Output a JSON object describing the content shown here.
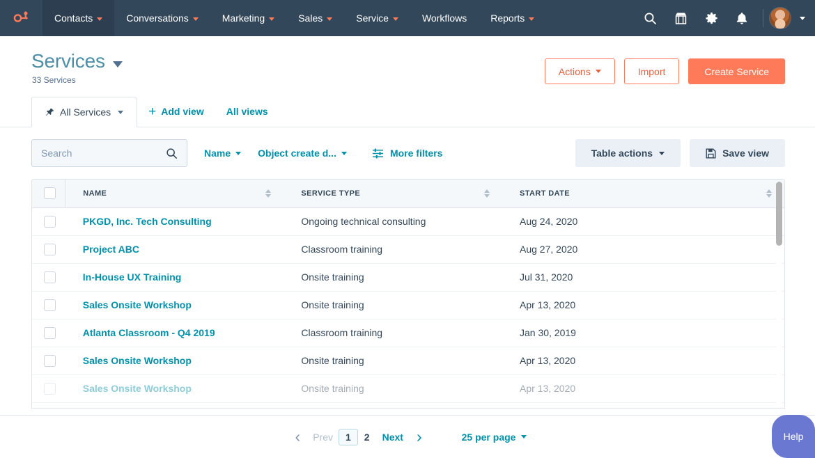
{
  "nav": {
    "logo": "hubspot-sprocket-logo",
    "items": [
      {
        "label": "Contacts",
        "has_caret": true,
        "active": true
      },
      {
        "label": "Conversations",
        "has_caret": true,
        "active": false
      },
      {
        "label": "Marketing",
        "has_caret": true,
        "active": false
      },
      {
        "label": "Sales",
        "has_caret": true,
        "active": false
      },
      {
        "label": "Service",
        "has_caret": true,
        "active": false
      },
      {
        "label": "Workflows",
        "has_caret": false,
        "active": false
      },
      {
        "label": "Reports",
        "has_caret": true,
        "active": false
      }
    ],
    "icons": [
      "search-icon",
      "marketplace-icon",
      "settings-gear-icon",
      "notifications-bell-icon"
    ],
    "bg_color": "#33475B",
    "active_bg_color": "#2D3E50",
    "accent_color": "#FF7A59"
  },
  "header": {
    "title": "Services",
    "subtitle": "33 Services",
    "actions_label": "Actions",
    "import_label": "Import",
    "create_label": "Create Service"
  },
  "tabs": {
    "active_label": "All Services",
    "add_view_label": "Add view",
    "all_views_label": "All views"
  },
  "filters": {
    "search_placeholder": "Search",
    "search_value": "",
    "dropdowns": [
      {
        "label": "Name"
      },
      {
        "label": "Object create d..."
      }
    ],
    "more_filters_label": "More filters",
    "table_actions_label": "Table actions",
    "save_view_label": "Save view"
  },
  "table": {
    "columns": [
      "NAME",
      "SERVICE TYPE",
      "START DATE"
    ],
    "rows": [
      {
        "name": "PKGD, Inc. Tech Consulting",
        "type": "Ongoing technical consulting",
        "date": "Aug 24, 2020"
      },
      {
        "name": "Project ABC",
        "type": "Classroom training",
        "date": "Aug 27, 2020"
      },
      {
        "name": "In-House UX Training",
        "type": "Onsite training",
        "date": "Jul 31, 2020"
      },
      {
        "name": "Sales Onsite Workshop",
        "type": "Onsite training",
        "date": "Apr 13, 2020"
      },
      {
        "name": "Atlanta Classroom - Q4 2019",
        "type": "Classroom training",
        "date": "Jan 30, 2019"
      },
      {
        "name": "Sales Onsite Workshop",
        "type": "Onsite training",
        "date": "Apr 13, 2020"
      },
      {
        "name": "Sales Onsite Workshop",
        "type": "Onsite training",
        "date": "Apr 13, 2020"
      }
    ],
    "link_color": "#0091AE"
  },
  "pagination": {
    "prev_label": "Prev",
    "pages": [
      "1",
      "2"
    ],
    "current_page": "1",
    "next_label": "Next",
    "per_page_label": "25 per page"
  },
  "help": {
    "label": "Help",
    "color": "#6A78D1"
  }
}
